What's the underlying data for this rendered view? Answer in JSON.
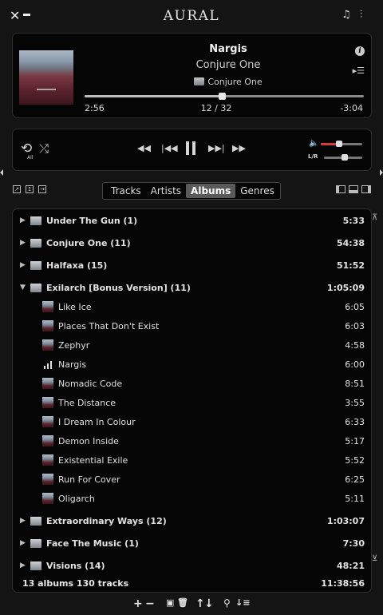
{
  "app": {
    "title": "AURAL"
  },
  "now_playing": {
    "title": "Nargis",
    "artist": "Conjure One",
    "album": "Conjure One",
    "elapsed": "2:56",
    "position": "12 / 32",
    "remaining": "-3:04",
    "progress_fraction": 0.49
  },
  "controls": {
    "repeat_label": "All",
    "volume_fraction": 0.45,
    "balance_fraction": 0.55,
    "balance_label": "L/R"
  },
  "tabs": [
    {
      "label": "Tracks",
      "active": false
    },
    {
      "label": "Artists",
      "active": false
    },
    {
      "label": "Albums",
      "active": true
    },
    {
      "label": "Genres",
      "active": false
    }
  ],
  "albums_before": [
    {
      "name": "Under The Gun (1)",
      "duration": "5:33"
    },
    {
      "name": "Conjure One (11)",
      "duration": "54:38"
    },
    {
      "name": "Halfaxa (15)",
      "duration": "51:52"
    }
  ],
  "expanded_album": {
    "name": "Exilarch [Bonus Version] (11)",
    "duration": "1:05:09"
  },
  "tracks": [
    {
      "name": "Like Ice",
      "duration": "6:05",
      "playing": false
    },
    {
      "name": "Places That Don't Exist",
      "duration": "6:03",
      "playing": false
    },
    {
      "name": "Zephyr",
      "duration": "4:58",
      "playing": false
    },
    {
      "name": "Nargis",
      "duration": "6:00",
      "playing": true
    },
    {
      "name": "Nomadic Code",
      "duration": "8:51",
      "playing": false
    },
    {
      "name": "The Distance",
      "duration": "3:55",
      "playing": false
    },
    {
      "name": "I Dream In Colour",
      "duration": "6:33",
      "playing": false
    },
    {
      "name": "Demon Inside",
      "duration": "5:17",
      "playing": false
    },
    {
      "name": "Existential Exile",
      "duration": "5:52",
      "playing": false
    },
    {
      "name": "Run For Cover",
      "duration": "6:25",
      "playing": false
    },
    {
      "name": "Oligarch",
      "duration": "5:11",
      "playing": false
    }
  ],
  "albums_after": [
    {
      "name": "Extraordinary Ways (12)",
      "duration": "1:03:07"
    },
    {
      "name": "Face The Music (1)",
      "duration": "7:30"
    },
    {
      "name": "Visions (14)",
      "duration": "48:21"
    }
  ],
  "summary": {
    "counts": "13 albums   130 tracks",
    "total": "11:38:56"
  },
  "icons": {
    "close": "close-icon",
    "minimize": "minimize-icon",
    "playlist": "playlist-icon",
    "equalizer": "equalizer-icon",
    "info": "info-icon",
    "queue": "queue-icon",
    "repeat": "repeat-icon",
    "shuffle": "shuffle-icon",
    "volume": "volume-icon"
  },
  "colors": {
    "accent_volume": "#d63b3b",
    "background": "#141414",
    "panel": "#050505"
  }
}
